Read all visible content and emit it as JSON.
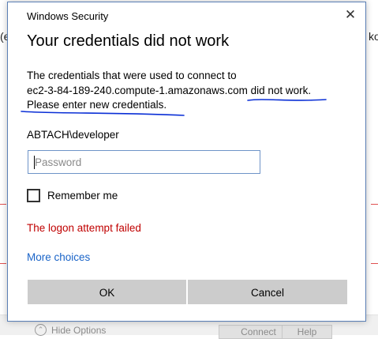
{
  "background": {
    "left_fragment": "(e",
    "right_fragment": "ko",
    "hide_options": "Hide Options",
    "connect": "Connect",
    "help": "Help"
  },
  "dialog": {
    "window_title": "Windows Security",
    "heading": "Your credentials did not work",
    "message_lines": [
      "The credentials that were used to connect to",
      "ec2-3-84-189-240.compute-1.amazonaws.com did not work.",
      "Please enter new credentials."
    ],
    "username": "ABTACH\\developer",
    "password": {
      "value": "",
      "placeholder": "Password"
    },
    "remember_me": {
      "label": "Remember me",
      "checked": false
    },
    "error": "The logon attempt failed",
    "more_choices": "More choices",
    "ok": "OK",
    "cancel": "Cancel"
  },
  "colors": {
    "accent_border": "#5a7fb5",
    "error": "#c00000",
    "link": "#1a64c8",
    "button_bg": "#cccccc",
    "ink_annotation": "#0a2fd6"
  },
  "icons": {
    "close": "close-icon",
    "show_hide_options": "chevron-up-icon"
  }
}
